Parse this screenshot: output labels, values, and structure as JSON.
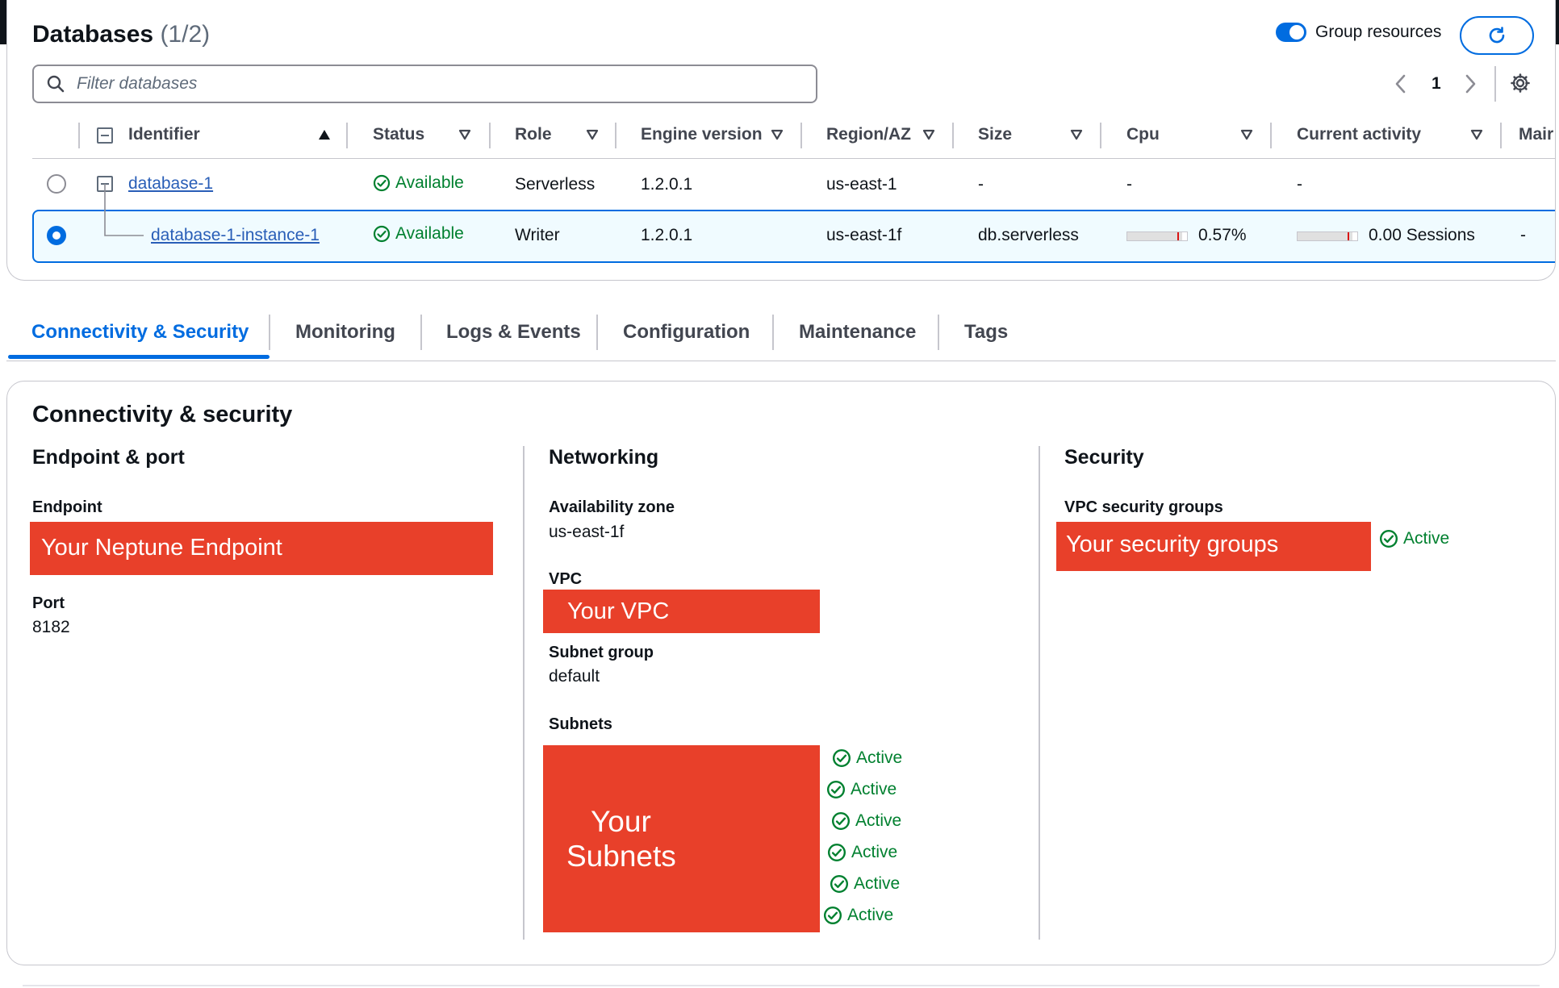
{
  "databases": {
    "title": "Databases",
    "count": "(1/2)",
    "group_resources_label": "Group resources",
    "group_resources_on": true,
    "filter_placeholder": "Filter databases",
    "page": "1",
    "columns": [
      "Identifier",
      "Status",
      "Role",
      "Engine version",
      "Region/AZ",
      "Size",
      "Cpu",
      "Current activity",
      "Mair"
    ],
    "rows": [
      {
        "identifier": "database-1",
        "status": "Available",
        "role": "Serverless",
        "engine_version": "1.2.0.1",
        "region": "us-east-1",
        "size": "-",
        "cpu": "-",
        "activity": "-",
        "maintenance": "",
        "selected": false
      },
      {
        "identifier": "database-1-instance-1",
        "status": "Available",
        "role": "Writer",
        "engine_version": "1.2.0.1",
        "region": "us-east-1f",
        "size": "db.serverless",
        "cpu": "0.57%",
        "activity": "0.00 Sessions",
        "maintenance": "-",
        "selected": true
      }
    ]
  },
  "tabs": [
    "Connectivity & Security",
    "Monitoring",
    "Logs & Events",
    "Configuration",
    "Maintenance",
    "Tags"
  ],
  "connectivity": {
    "title": "Connectivity & security",
    "endpoint_section": {
      "heading": "Endpoint & port",
      "endpoint_label": "Endpoint",
      "endpoint_value": "Your Neptune Endpoint",
      "port_label": "Port",
      "port_value": "8182"
    },
    "networking_section": {
      "heading": "Networking",
      "az_label": "Availability zone",
      "az_value": "us-east-1f",
      "vpc_label": "VPC",
      "vpc_value": "Your VPC",
      "subnet_group_label": "Subnet group",
      "subnet_group_value": "default",
      "subnets_label": "Subnets",
      "subnets_value_line1": "Your",
      "subnets_value_line2": "Subnets",
      "subnet_statuses": [
        "Active",
        "Active",
        "Active",
        "Active",
        "Active",
        "Active"
      ]
    },
    "security_section": {
      "heading": "Security",
      "sg_label": "VPC security groups",
      "sg_value": "Your security groups",
      "sg_status": "Active"
    }
  },
  "colors": {
    "accent": "#006ce0",
    "success": "#00802f",
    "redaction": "#e8402a",
    "link": "#295eb7"
  }
}
